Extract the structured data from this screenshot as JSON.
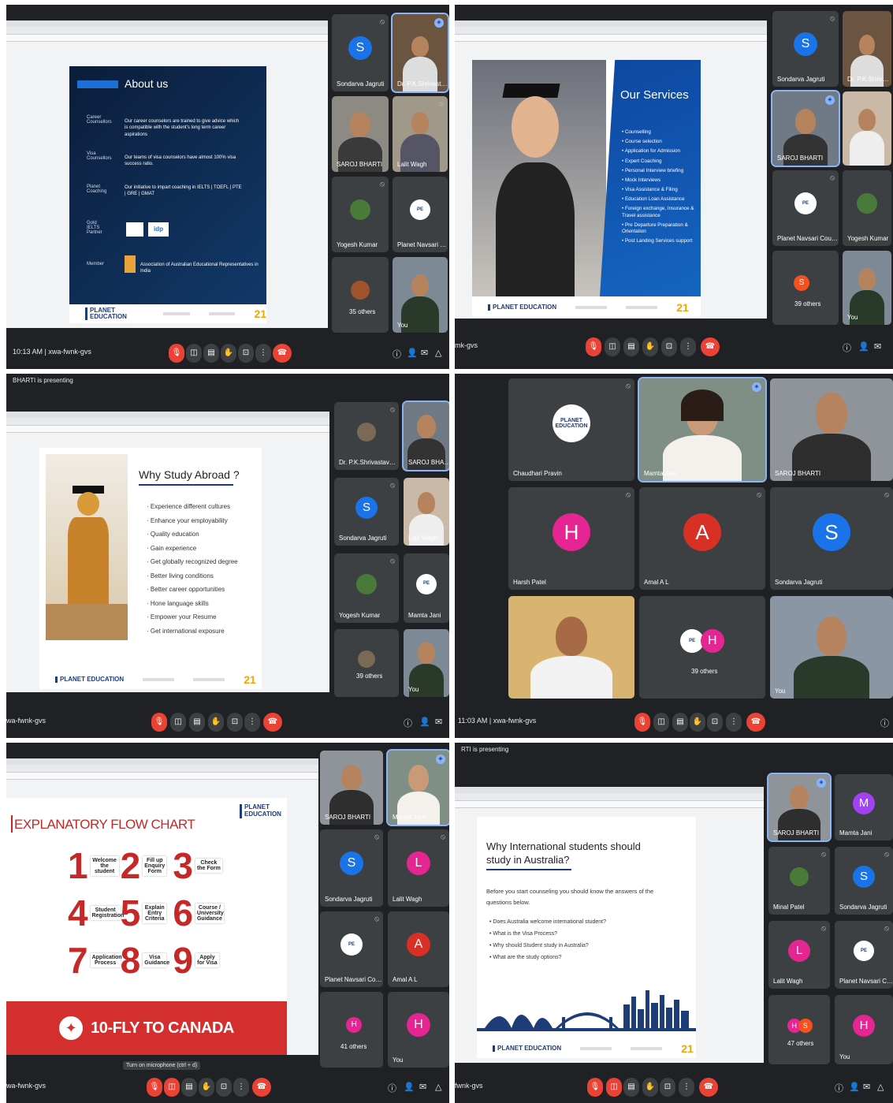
{
  "panels": {
    "p1": {
      "time": "10:13 AM",
      "code": "xwa-fwnk-gvs",
      "slide": {
        "title": "About us",
        "rows": [
          {
            "label": "Career Counsellors",
            "text": "Our career counselors are trained to give advice which is compatible with the student's long term career aspirations"
          },
          {
            "label": "Visa Counsellors",
            "text": "Our teams of visa counselors have almost 100% visa success ratio."
          },
          {
            "label": "Planet Coaching",
            "text": "Our initiative to impart coaching in IELTS | TOEFL | PTE | GRE | GMAT"
          },
          {
            "label": "Gold IELTS Partner",
            "text": "idp"
          },
          {
            "label": "Member",
            "text": "Association of Australian Educational Representatives in India"
          }
        ],
        "footer_logo": "PLANET EDUCATION",
        "footer_badge": "21"
      },
      "tiles": [
        {
          "name": "Sondarva Jagruti",
          "initial": "S",
          "color": "#1a73e8"
        },
        {
          "name": "Dr. P.K.Shrivastava AC..."
        },
        {
          "name": "SAROJ BHARTI"
        },
        {
          "name": "Lalit Wagh"
        },
        {
          "name": "Yogesh Kumar"
        },
        {
          "name": "Planet Navsari Counse..."
        },
        {
          "name": "35 others"
        },
        {
          "name": "You"
        }
      ]
    },
    "p2": {
      "code": "mk-gvs",
      "slide": {
        "title": "Our Services",
        "items": [
          "Counselling",
          "Course selection",
          "Application for Admission",
          "Expert Coaching",
          "Personal Interview briefing",
          "Mock Interviews",
          "Visa Assistance & Filing",
          "Education Loan Assistance",
          "Foreign exchange, Insurance & Travel assistance",
          "Pre Departure Preparation & Orientation",
          "Post Landing Services support"
        ],
        "footer_logo": "PLANET EDUCATION",
        "footer_badge": "21"
      },
      "tiles": [
        {
          "name": "Sondarva Jagruti",
          "initial": "S"
        },
        {
          "name": "Dr. P.K.Shrivastava"
        },
        {
          "name": "SAROJ BHARTI"
        },
        {
          "name": ""
        },
        {
          "name": "Planet Navsari Counse..."
        },
        {
          "name": "Yogesh Kumar"
        },
        {
          "name": "39 others"
        },
        {
          "name": "You"
        }
      ]
    },
    "p3": {
      "presenting": "BHARTI is presenting",
      "code": "wa-fwnk-gvs",
      "slide": {
        "title": "Why Study Abroad ?",
        "items": [
          "Experience different cultures",
          "Enhance your employability",
          "Quality education",
          "Gain experience",
          "Get globally recognized degree",
          "Better living conditions",
          "Better career opportunities",
          "Hone language skills",
          "Empower your Resume",
          "Get international exposure"
        ],
        "footer_logo": "PLANET EDUCATION",
        "footer_badge": "21"
      },
      "tiles": [
        {
          "name": "Dr. P.K.Shrivastava AC..."
        },
        {
          "name": "SAROJ BHARTI"
        },
        {
          "name": "Sondarva Jagruti",
          "initial": "S"
        },
        {
          "name": "Lalit Wagh"
        },
        {
          "name": "Yogesh Kumar"
        },
        {
          "name": "Mamta Jani"
        },
        {
          "name": "39 others"
        },
        {
          "name": "You"
        }
      ]
    },
    "p4": {
      "time": "11:03 AM",
      "code": "xwa-fwnk-gvs",
      "tiles": [
        {
          "name": "Chaudhari Pravin",
          "logo": "PLANET EDUCATION"
        },
        {
          "name": "Mamta Jani"
        },
        {
          "name": "SAROJ BHARTI"
        },
        {
          "name": "Harsh Patel",
          "initial": "H",
          "color": "#e52592"
        },
        {
          "name": "Amal A L",
          "initial": "A",
          "color": "#d93025"
        },
        {
          "name": "Sondarva Jagruti",
          "initial": "S",
          "color": "#1a73e8"
        },
        {
          "name": ""
        },
        {
          "name": "39 others",
          "initial": "H"
        },
        {
          "name": "You"
        }
      ]
    },
    "p5": {
      "code": "wa-fwnk-gvs",
      "tooltip": "Turn on microphone (ctrl + d)",
      "slide": {
        "title": "EXPLANATORY FLOW CHART",
        "logo": "PLANET EDUCATION",
        "steps": [
          {
            "n": "1",
            "t": "Welcome the student"
          },
          {
            "n": "2",
            "t": "Fill up Enquiry Form"
          },
          {
            "n": "3",
            "t": "Check the Form"
          },
          {
            "n": "4",
            "t": "Student Registration"
          },
          {
            "n": "5",
            "t": "Explain Entry Criteria"
          },
          {
            "n": "6",
            "t": "Course / University Guidance"
          },
          {
            "n": "7",
            "t": "Application Process"
          },
          {
            "n": "8",
            "t": "Visa Guidance"
          },
          {
            "n": "9",
            "t": "Apply for Visa"
          }
        ],
        "banner": "10-FLY TO CANADA"
      },
      "tiles": [
        {
          "name": "SAROJ BHARTI"
        },
        {
          "name": "Mamta Jani"
        },
        {
          "name": "Sondarva Jagruti",
          "initial": "S",
          "color": "#1a73e8"
        },
        {
          "name": "Lalit Wagh",
          "initial": "L",
          "color": "#e52592"
        },
        {
          "name": "Planet Navsari Counse..."
        },
        {
          "name": "Amal A L",
          "initial": "A",
          "color": "#d93025"
        },
        {
          "name": "41 others"
        },
        {
          "name": "You",
          "initial": "H",
          "color": "#e52592"
        }
      ]
    },
    "p6": {
      "presenting": "RTI is presenting",
      "code": "fwnk-gvs",
      "slide": {
        "title": "Why International students should study in Australia?",
        "intro": "Before you start counseling you should know the answers of the questions below.",
        "items": [
          "Does Australia welcome international student?",
          "What is the Visa Process?",
          "Why should Student study in Australia?",
          "What are the study options?"
        ],
        "footer_logo": "PLANET EDUCATION",
        "footer_badge": "21"
      },
      "tiles": [
        {
          "name": "SAROJ BHARTI"
        },
        {
          "name": "Mamta Jani",
          "initial": "M",
          "color": "#a142f4"
        },
        {
          "name": "Minal Patel"
        },
        {
          "name": "Sondarva Jagruti",
          "initial": "S",
          "color": "#1a73e8"
        },
        {
          "name": "Lalit Wagh",
          "initial": "L",
          "color": "#e52592"
        },
        {
          "name": "Planet Navsari Counse..."
        },
        {
          "name": "47 others"
        },
        {
          "name": "You",
          "initial": "H",
          "color": "#e52592"
        }
      ]
    }
  }
}
